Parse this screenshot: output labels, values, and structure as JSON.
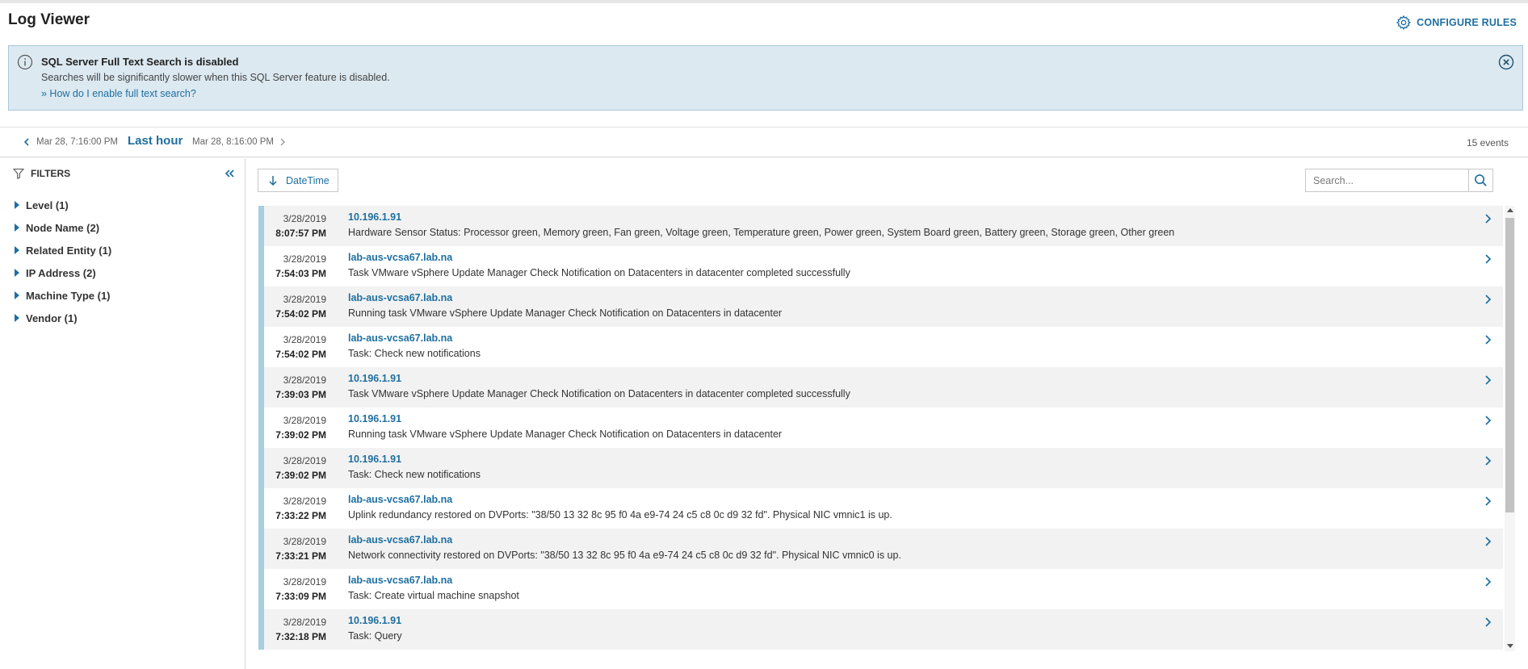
{
  "page": {
    "title": "Log Viewer",
    "configure_label": "CONFIGURE RULES"
  },
  "banner": {
    "title": "SQL Server Full Text Search is disabled",
    "text": "Searches will be significantly slower when this SQL Server feature is disabled.",
    "link": "» How do I enable full text search?"
  },
  "timebar": {
    "start": "Mar 28, 7:16:00 PM",
    "range": "Last hour",
    "end": "Mar 28, 8:16:00 PM",
    "count": "15 events"
  },
  "filters": {
    "heading": "FILTERS",
    "items": [
      {
        "label": "Level (1)"
      },
      {
        "label": "Node Name (2)"
      },
      {
        "label": "Related Entity (1)"
      },
      {
        "label": "IP Address (2)"
      },
      {
        "label": "Machine Type (1)"
      },
      {
        "label": "Vendor (1)"
      }
    ]
  },
  "toolbar": {
    "sort_label": "DateTime",
    "search_placeholder": "Search..."
  },
  "events": [
    {
      "date": "3/28/2019",
      "time": "8:07:57 PM",
      "source": "10.196.1.91",
      "message": "Hardware Sensor Status: Processor green, Memory green, Fan green, Voltage green, Temperature green, Power green, System Board green, Battery green, Storage green, Other green"
    },
    {
      "date": "3/28/2019",
      "time": "7:54:03 PM",
      "source": "lab-aus-vcsa67.lab.na",
      "message": "Task VMware vSphere Update Manager Check Notification on Datacenters in datacenter completed successfully"
    },
    {
      "date": "3/28/2019",
      "time": "7:54:02 PM",
      "source": "lab-aus-vcsa67.lab.na",
      "message": "Running task VMware vSphere Update Manager Check Notification on Datacenters in datacenter"
    },
    {
      "date": "3/28/2019",
      "time": "7:54:02 PM",
      "source": "lab-aus-vcsa67.lab.na",
      "message": "Task: Check new notifications"
    },
    {
      "date": "3/28/2019",
      "time": "7:39:03 PM",
      "source": "10.196.1.91",
      "message": "Task VMware vSphere Update Manager Check Notification on Datacenters in datacenter completed successfully"
    },
    {
      "date": "3/28/2019",
      "time": "7:39:02 PM",
      "source": "10.196.1.91",
      "message": "Running task VMware vSphere Update Manager Check Notification on Datacenters in datacenter"
    },
    {
      "date": "3/28/2019",
      "time": "7:39:02 PM",
      "source": "10.196.1.91",
      "message": "Task: Check new notifications"
    },
    {
      "date": "3/28/2019",
      "time": "7:33:22 PM",
      "source": "lab-aus-vcsa67.lab.na",
      "message": "Uplink redundancy restored on DVPorts: \"38/50 13 32 8c 95 f0 4a e9-74 24 c5 c8 0c d9 32 fd\". Physical NIC vmnic1 is up."
    },
    {
      "date": "3/28/2019",
      "time": "7:33:21 PM",
      "source": "lab-aus-vcsa67.lab.na",
      "message": "Network connectivity restored on DVPorts: \"38/50 13 32 8c 95 f0 4a e9-74 24 c5 c8 0c d9 32 fd\". Physical NIC vmnic0 is up."
    },
    {
      "date": "3/28/2019",
      "time": "7:33:09 PM",
      "source": "lab-aus-vcsa67.lab.na",
      "message": "Task: Create virtual machine snapshot"
    },
    {
      "date": "3/28/2019",
      "time": "7:32:18 PM",
      "source": "10.196.1.91",
      "message": "Task: Query"
    }
  ],
  "colors": {
    "accent": "#1e6fa0",
    "banner_bg": "#dce9f1",
    "row_marker": "#a7cfe0",
    "row_alt": "#f2f2f2"
  },
  "icons": [
    "gear-icon",
    "info-icon",
    "close-circle-icon",
    "chevron-left-icon",
    "chevron-right-icon",
    "filter-icon",
    "double-chevron-left-icon",
    "sort-down-arrow-icon",
    "search-icon"
  ]
}
